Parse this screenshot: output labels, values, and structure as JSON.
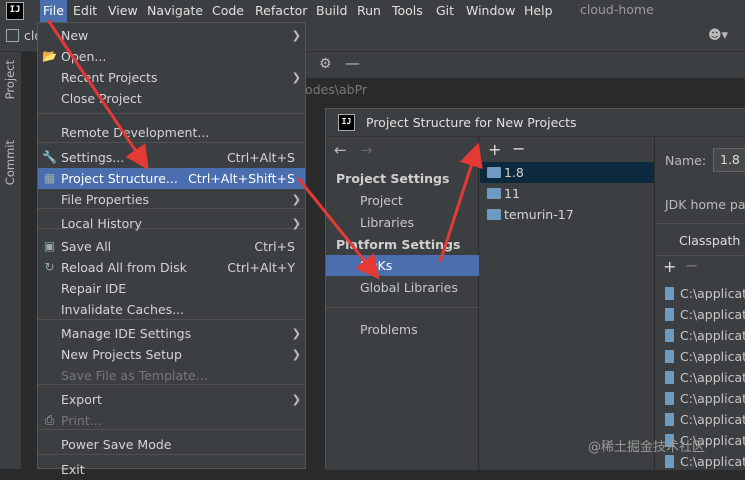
{
  "menubar": {
    "items": [
      "File",
      "Edit",
      "View",
      "Navigate",
      "Code",
      "Refactor",
      "Build",
      "Run",
      "Tools",
      "Git",
      "Window",
      "Help"
    ],
    "project_name": "cloud-home",
    "logo": "IJ"
  },
  "toolbar": {
    "crumb": "clo"
  },
  "stripe": {
    "project_label": "Project",
    "commit_label": "Commit"
  },
  "editor": {
    "path_fragment": "odes\\abPr"
  },
  "file_menu": [
    {
      "label": "New",
      "shortcut": "",
      "submenu": true,
      "icon": ""
    },
    {
      "label": "Open...",
      "shortcut": "",
      "submenu": false,
      "icon": "folder-icon"
    },
    {
      "label": "Recent Projects",
      "shortcut": "",
      "submenu": true,
      "icon": ""
    },
    {
      "label": "Close Project",
      "shortcut": "",
      "submenu": false,
      "icon": ""
    },
    {
      "label": "Remote Development...",
      "shortcut": "",
      "submenu": false,
      "icon": ""
    },
    {
      "label": "Settings...",
      "shortcut": "Ctrl+Alt+S",
      "submenu": false,
      "icon": "wrench-icon"
    },
    {
      "label": "Project Structure...",
      "shortcut": "Ctrl+Alt+Shift+S",
      "submenu": false,
      "icon": "project-structure-icon",
      "selected": true
    },
    {
      "label": "File Properties",
      "shortcut": "",
      "submenu": true,
      "icon": ""
    },
    {
      "label": "Local History",
      "shortcut": "",
      "submenu": true,
      "icon": ""
    },
    {
      "label": "Save All",
      "shortcut": "Ctrl+S",
      "submenu": false,
      "icon": "save-icon"
    },
    {
      "label": "Reload All from Disk",
      "shortcut": "Ctrl+Alt+Y",
      "submenu": false,
      "icon": "reload-icon"
    },
    {
      "label": "Repair IDE",
      "shortcut": "",
      "submenu": false,
      "icon": ""
    },
    {
      "label": "Invalidate Caches...",
      "shortcut": "",
      "submenu": false,
      "icon": ""
    },
    {
      "label": "Manage IDE Settings",
      "shortcut": "",
      "submenu": true,
      "icon": ""
    },
    {
      "label": "New Projects Setup",
      "shortcut": "",
      "submenu": true,
      "icon": ""
    },
    {
      "label": "Save File as Template...",
      "shortcut": "",
      "submenu": false,
      "icon": "",
      "disabled": true
    },
    {
      "label": "Export",
      "shortcut": "",
      "submenu": true,
      "icon": ""
    },
    {
      "label": "Print...",
      "shortcut": "",
      "submenu": false,
      "icon": "print-icon",
      "disabled": true
    },
    {
      "label": "Power Save Mode",
      "shortcut": "",
      "submenu": false,
      "icon": ""
    },
    {
      "label": "Exit",
      "shortcut": "",
      "submenu": false,
      "icon": ""
    }
  ],
  "dialog": {
    "title": "Project Structure for New Projects",
    "logo": "IJ",
    "nav": {
      "project_settings_header": "Project Settings",
      "project_settings": [
        "Project",
        "Libraries"
      ],
      "platform_settings_header": "Platform Settings",
      "platform_settings": [
        "SDKs",
        "Global Libraries"
      ],
      "selected": "SDKs",
      "problems": "Problems"
    },
    "sdks": [
      {
        "name": "1.8",
        "selected": true
      },
      {
        "name": "11",
        "selected": false
      },
      {
        "name": "temurin-17",
        "selected": false
      }
    ],
    "detail": {
      "name_label": "Name:",
      "name_value": "1.8",
      "jdk_home_label": "JDK home pat",
      "tab": "Classpath",
      "classpath_rows": [
        "C:\\applicati",
        "C:\\applicati",
        "C:\\applicati",
        "C:\\applicati",
        "C:\\applicati",
        "C:\\applicati",
        "C:\\applicati",
        "C:\\applicati",
        "C:\\applicati"
      ]
    }
  },
  "watermark": "@稀土掘金技术社区",
  "colors": {
    "selection": "#4b6eaf",
    "arrow": "#e53935",
    "sdk_selection": "#0d293e"
  }
}
